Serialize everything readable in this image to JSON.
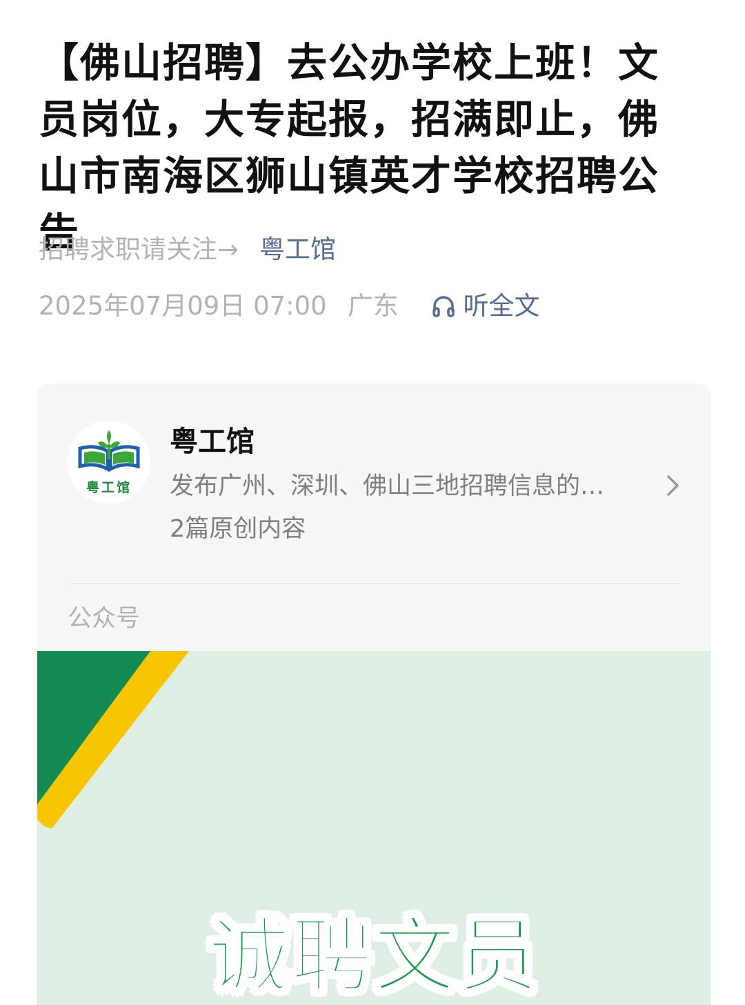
{
  "article": {
    "title": "【佛山招聘】去公办学校上班！文员岗位，大专起报，招满即止，佛山市南海区狮山镇英才学校招聘公告",
    "follow_prompt": "招聘求职请关注→",
    "follow_account": "粤工馆",
    "datetime": "2025年07月09日 07:00",
    "region": "广东",
    "listen_label": "听全文"
  },
  "account_card": {
    "avatar_text": "粤工馆",
    "name": "粤工馆",
    "description": "发布广州、深圳、佛山三地招聘信息的…",
    "original_count": "2篇原创内容",
    "footer_label": "公众号"
  },
  "banner": {
    "headline": "诚聘文员"
  },
  "colors": {
    "link": "#576b95",
    "banner_bg": "#deeee3",
    "banner_green": "#148a55",
    "banner_yellow": "#f7c600",
    "headline_green": "#1a9b49"
  }
}
